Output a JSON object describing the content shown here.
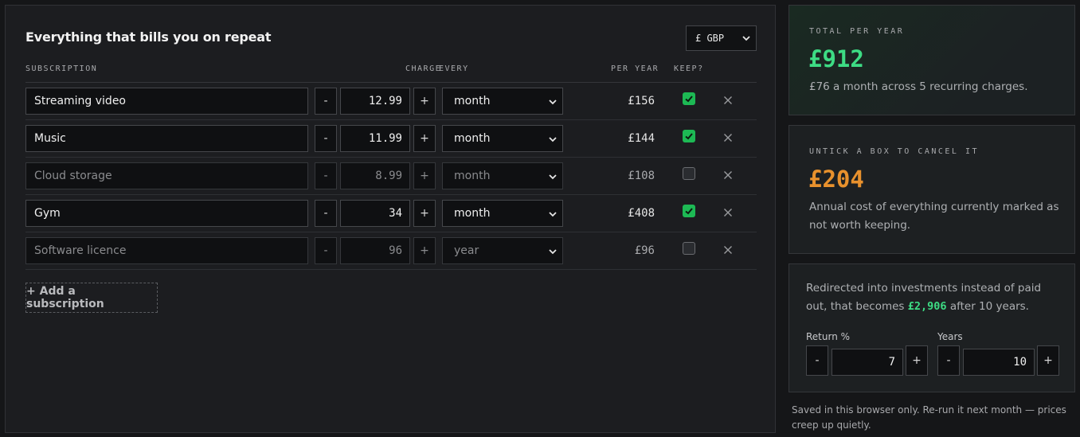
{
  "main": {
    "title": "Everything that bills you on repeat",
    "currency": "£ GBP",
    "columns": {
      "subscription": "SUBSCRIPTION",
      "charge": "CHARGE",
      "every": "EVERY",
      "per_year": "PER YEAR",
      "keep": "KEEP?"
    },
    "rows": [
      {
        "name": "Streaming video",
        "amount": "12.99",
        "period": "month",
        "per_year": "£156",
        "keep": true
      },
      {
        "name": "Music",
        "amount": "11.99",
        "period": "month",
        "per_year": "£144",
        "keep": true
      },
      {
        "name": "Cloud storage",
        "amount": "8.99",
        "period": "month",
        "per_year": "£108",
        "keep": false
      },
      {
        "name": "Gym",
        "amount": "34",
        "period": "month",
        "per_year": "£408",
        "keep": true
      },
      {
        "name": "Software licence",
        "amount": "96",
        "period": "year",
        "per_year": "£96",
        "keep": false
      }
    ],
    "minus_label": "-",
    "plus_label": "+",
    "add_label": "+ Add a subscription"
  },
  "total_card": {
    "label": "TOTAL PER YEAR",
    "value": "£912",
    "text": "£76 a month across 5 recurring charges."
  },
  "cancel_card": {
    "label": "UNTICK A BOX TO CANCEL IT",
    "value": "£204",
    "text_line1": "Annual cost of everything currently marked as",
    "text_line2": "not worth keeping."
  },
  "invest_card": {
    "text_before": "Redirected into investments instead of paid out, that becomes ",
    "amount": "£2,906",
    "text_after": " after 10 years.",
    "return_label": "Return %",
    "return_value": "7",
    "years_label": "Years",
    "years_value": "10",
    "minus_label": "-",
    "plus_label": "+"
  },
  "footnote": "Saved in this browser only. Re-run it next month — prices creep up quietly.",
  "colors": {
    "accent_green": "#3ddc84",
    "accent_orange": "#e8912d",
    "checkbox_green": "#1db954"
  }
}
